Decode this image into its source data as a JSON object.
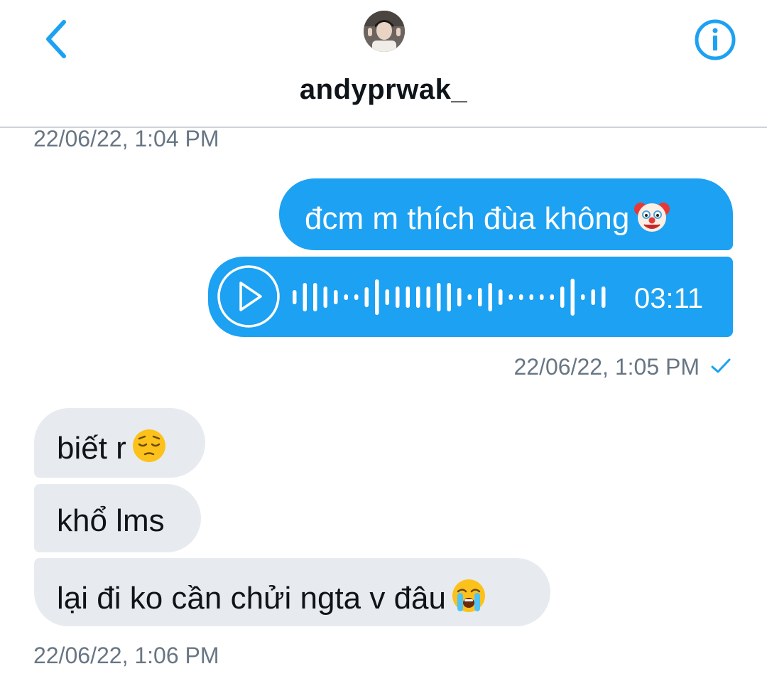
{
  "header": {
    "username": "andyprwak_",
    "back_icon": "chevron-left-icon",
    "info_icon": "info-icon",
    "accent_color": "#1da1f2"
  },
  "messages": [
    {
      "type": "timestamp",
      "text": "22/06/22, 1:04 PM"
    },
    {
      "type": "outgoing-text",
      "text": "đcm m thích đùa không",
      "emoji": "clown-face"
    },
    {
      "type": "outgoing-voice",
      "duration": "03:11",
      "icon": "play-icon"
    },
    {
      "type": "timestamp",
      "text": "22/06/22, 1:05 PM",
      "status_icon": "check-icon"
    },
    {
      "type": "incoming-text",
      "text": "biết r",
      "emoji": "pensive-face"
    },
    {
      "type": "incoming-text",
      "text": "khổ lms"
    },
    {
      "type": "incoming-text",
      "text": "lại đi ko cần chửi ngta v đâu",
      "emoji": "loudly-crying-face"
    },
    {
      "type": "timestamp",
      "text": "22/06/22, 1:06 PM"
    }
  ],
  "colors": {
    "outgoing_bubble": "#1da1f2",
    "incoming_bubble": "#e7ebef",
    "timestamp": "#687684"
  }
}
